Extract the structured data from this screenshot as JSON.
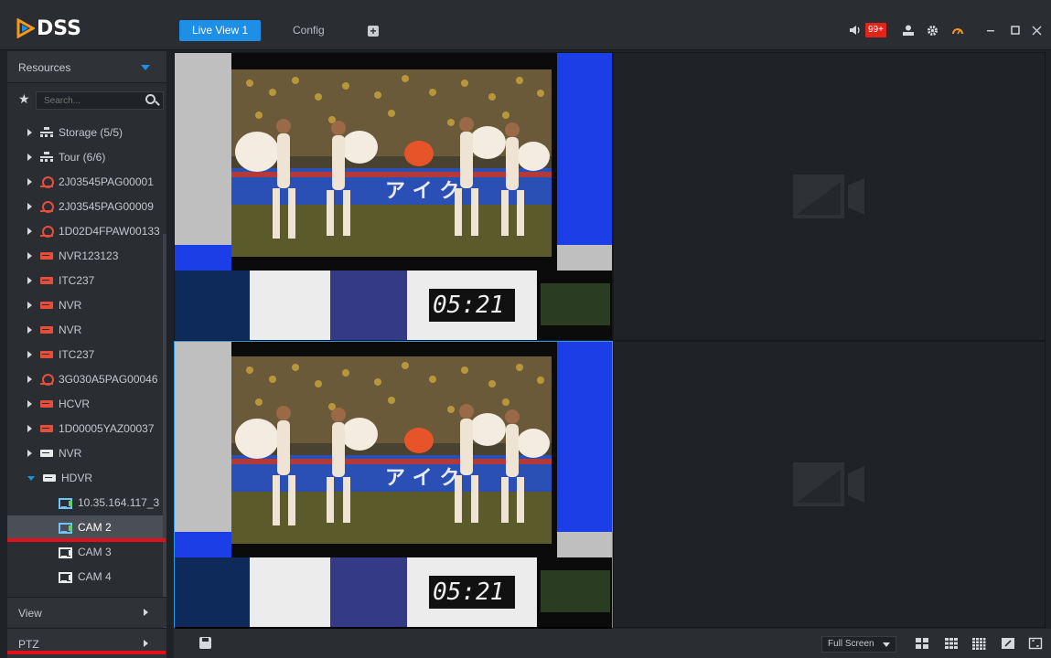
{
  "app": {
    "logo_text": "DSS",
    "tabs": [
      {
        "label": "Live View 1",
        "active": true
      },
      {
        "label": "Config",
        "active": false
      }
    ],
    "notification_count": "99+",
    "accent_color": "#1e8fe6"
  },
  "sidebar": {
    "resources_label": "Resources",
    "search_placeholder": "Search...",
    "tree": [
      {
        "label": "Storage (5/5)",
        "icon": "network-icon",
        "expanded": false
      },
      {
        "label": "Tour (6/6)",
        "icon": "network-icon",
        "expanded": false
      },
      {
        "label": "2J03545PAG00001",
        "icon": "camera-device-icon",
        "expanded": false
      },
      {
        "label": "2J03545PAG00009",
        "icon": "camera-device-icon",
        "expanded": false
      },
      {
        "label": "1D02D4FPAW00133",
        "icon": "camera-device-icon",
        "expanded": false
      },
      {
        "label": "NVR123123",
        "icon": "nvr-icon",
        "expanded": false
      },
      {
        "label": "ITC237",
        "icon": "nvr-icon",
        "expanded": false
      },
      {
        "label": "NVR",
        "icon": "nvr-icon",
        "expanded": false
      },
      {
        "label": "NVR",
        "icon": "nvr-icon",
        "expanded": false
      },
      {
        "label": "ITC237",
        "icon": "nvr-icon",
        "expanded": false
      },
      {
        "label": "3G030A5PAG00046",
        "icon": "camera-device-icon",
        "expanded": false
      },
      {
        "label": "HCVR",
        "icon": "nvr-icon",
        "expanded": false
      },
      {
        "label": "1D00005YAZ00037",
        "icon": "nvr-icon",
        "expanded": false
      },
      {
        "label": "NVR",
        "icon": "offline-nvr-icon",
        "expanded": false
      },
      {
        "label": "HDVR",
        "icon": "offline-nvr-icon",
        "expanded": true
      }
    ],
    "channels": [
      {
        "label": "10.35.164.117_3",
        "selected": false
      },
      {
        "label": "CAM 2",
        "selected": true
      },
      {
        "label": "CAM 3",
        "selected": false
      },
      {
        "label": "CAM 4",
        "selected": false
      }
    ],
    "view_label": "View",
    "ptz_label": "PTZ"
  },
  "video": {
    "timestamp_top": "05:21",
    "timestamp_bottom": "05:21",
    "overlay_text": "ア イ ク"
  },
  "bottombar": {
    "fullscreen_label": "Full Screen"
  }
}
